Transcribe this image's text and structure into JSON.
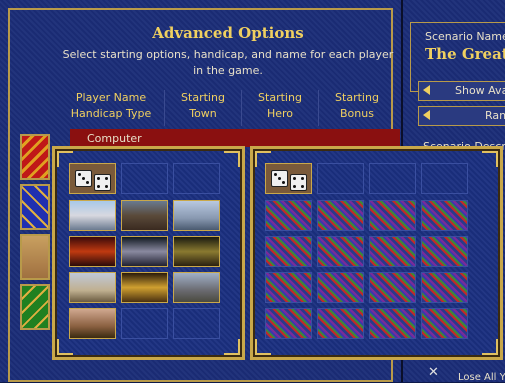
{
  "advanced_options": {
    "title": "Advanced Options",
    "description": "Select starting options, handicap, and name for each player in the game.",
    "columns": [
      {
        "line1": "Player Name",
        "line2": "Handicap Type"
      },
      {
        "line1": "Starting",
        "line2": "Town"
      },
      {
        "line1": "Starting",
        "line2": "Hero"
      },
      {
        "line1": "Starting",
        "line2": "Bonus"
      }
    ],
    "player_row_label": "Computer"
  },
  "right_panel": {
    "scenario_label": "Scenario Name:",
    "scenario_name": "The Great F",
    "show_button": "Show Avai",
    "random_button": "Ran",
    "scenario_desc": "Scenario Descri",
    "loss_text": "Lose All Y"
  },
  "town_popup": {
    "random_icon": "dice-icon",
    "towns": [
      "castle",
      "rampart",
      "tower",
      "inferno",
      "necropolis",
      "dungeon",
      "stronghold",
      "fortress",
      "conflux",
      "cove"
    ]
  },
  "bonus_popup": {
    "random_icon": "dice-icon",
    "rows": 4,
    "cols": 4
  },
  "colors": {
    "panel_blue": "#1b2d78",
    "gold_text": "#f0d060",
    "frame_gold": "#c9a84a",
    "computer_red": "#8a1010"
  }
}
